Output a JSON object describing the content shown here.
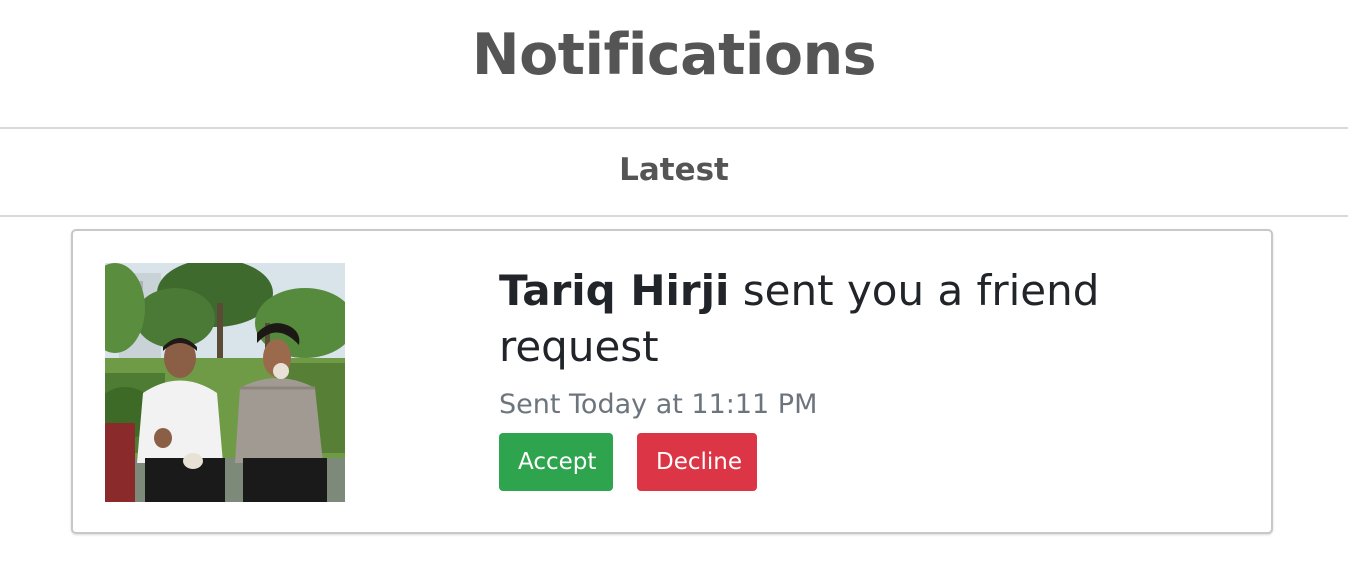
{
  "header": {
    "title": "Notifications"
  },
  "section": {
    "heading": "Latest"
  },
  "notifications": [
    {
      "sender": "Tariq Hirji",
      "message": " sent you a friend request",
      "timestamp": "Sent Today at 11:11 PM",
      "accept_label": "Accept",
      "decline_label": "Decline"
    }
  ],
  "colors": {
    "accept": "#2ea44f",
    "decline": "#dc3545",
    "heading": "#555555",
    "muted": "#6c757d"
  }
}
